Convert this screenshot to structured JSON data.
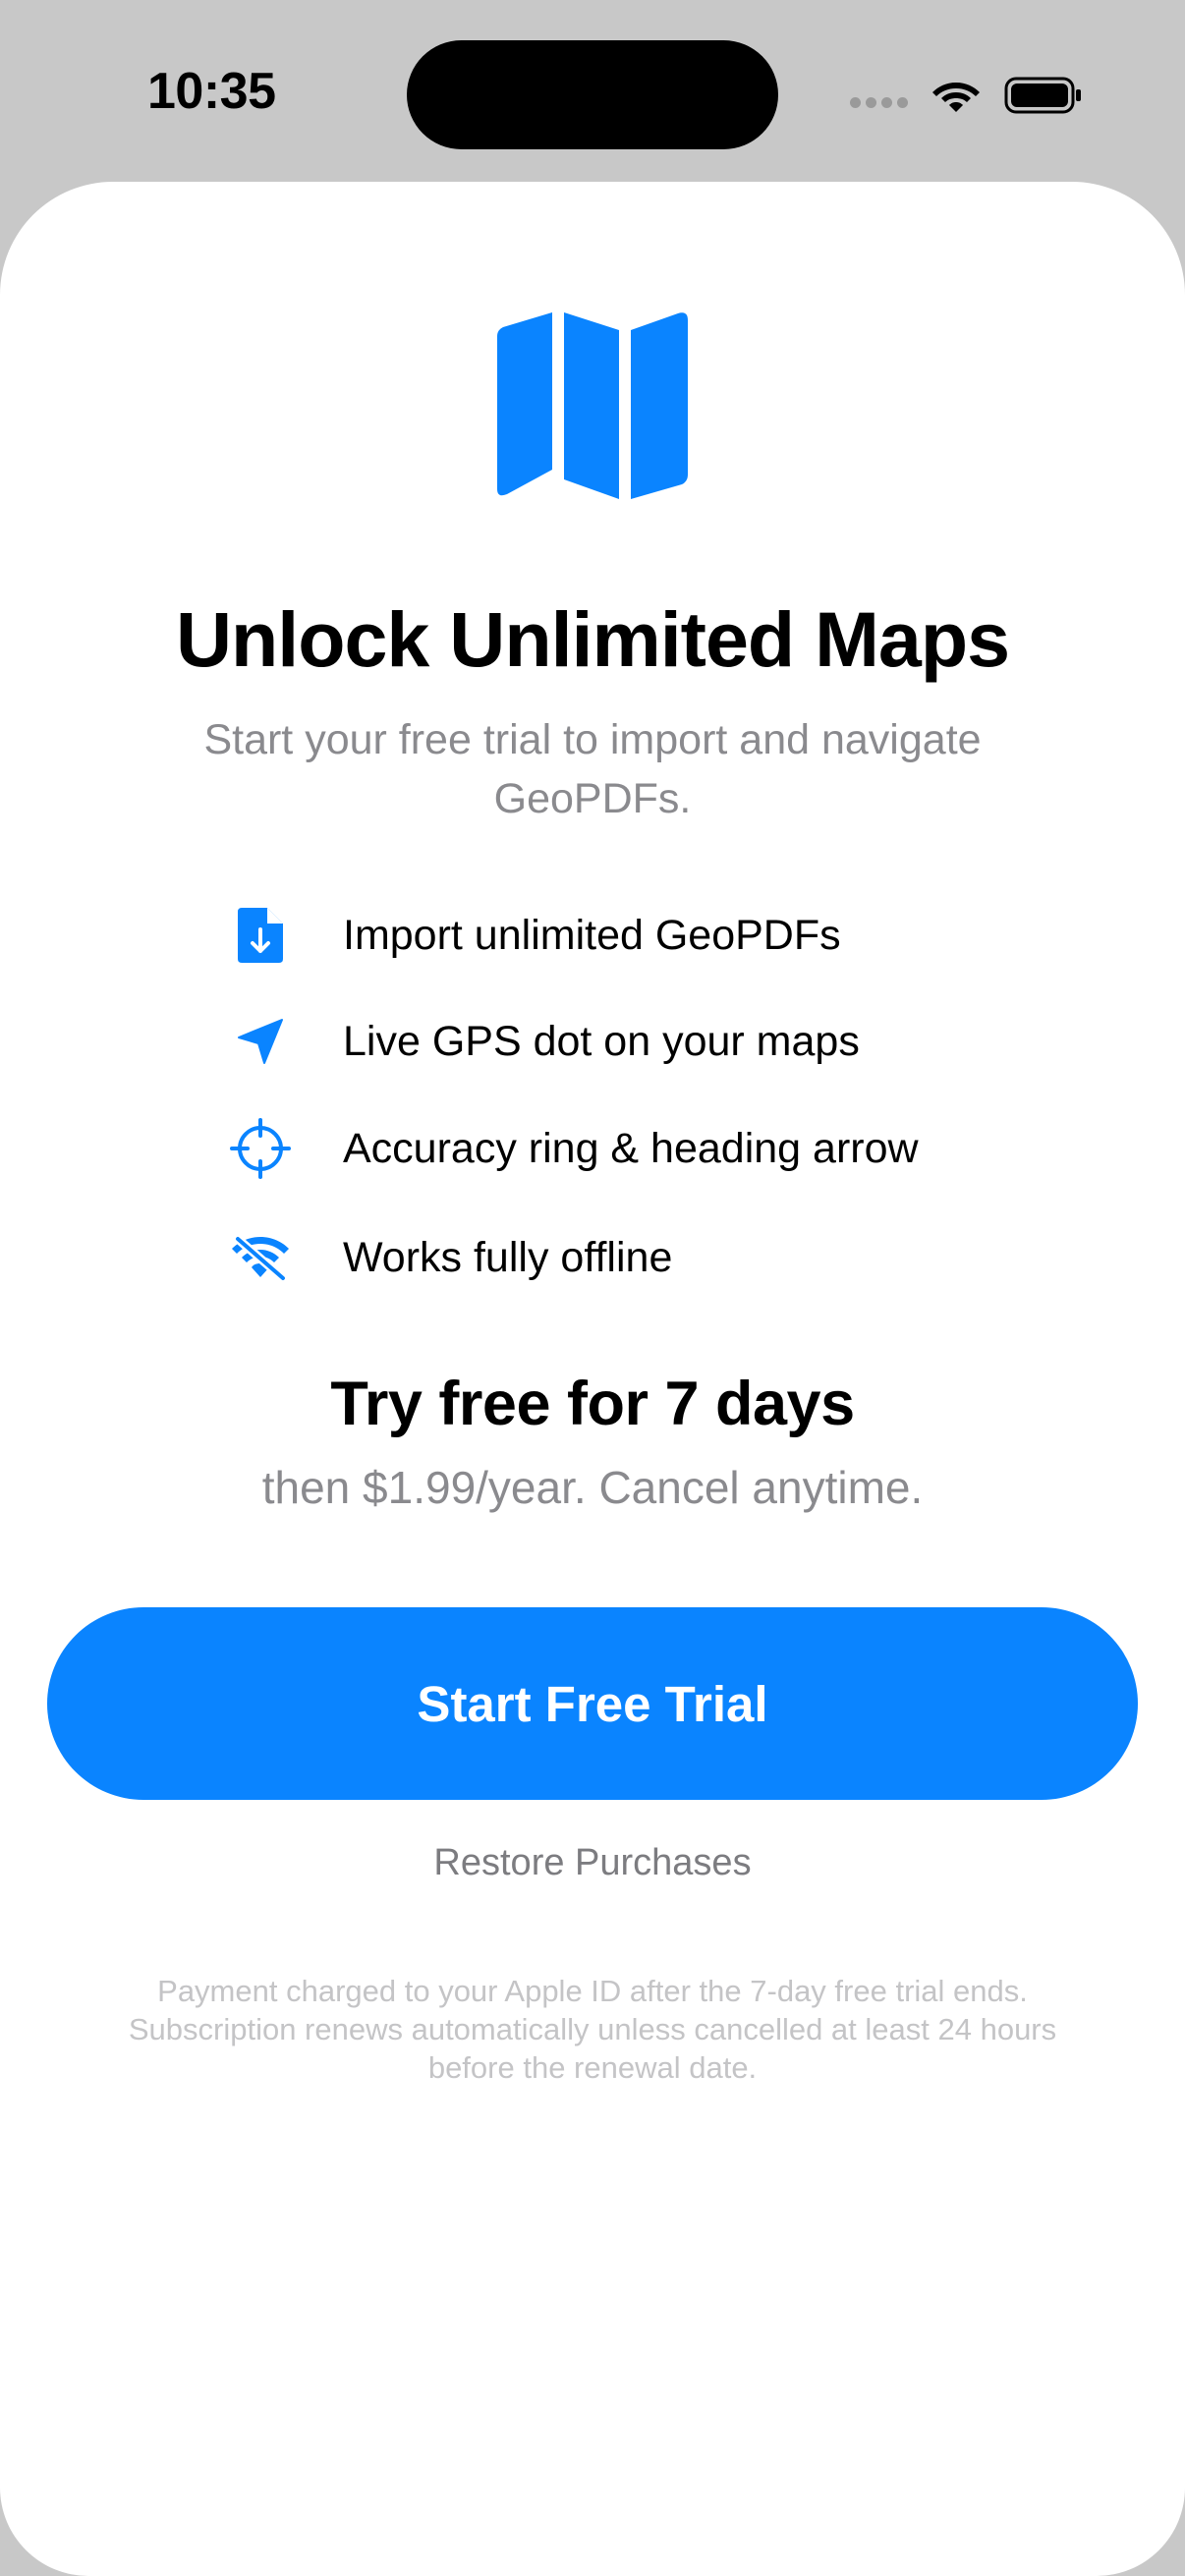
{
  "status_bar": {
    "time": "10:35",
    "icons": [
      "cellular-icon",
      "wifi-icon",
      "battery-icon"
    ]
  },
  "paywall": {
    "icon": "map-icon",
    "title": "Unlock Unlimited Maps",
    "subtitle": "Start your free trial to import and navigate GeoPDFs.",
    "features": [
      {
        "icon": "document-download-icon",
        "label": "Import unlimited GeoPDFs"
      },
      {
        "icon": "location-arrow-icon",
        "label": "Live GPS dot on your maps"
      },
      {
        "icon": "crosshair-icon",
        "label": "Accuracy ring & heading arrow"
      },
      {
        "icon": "wifi-off-icon",
        "label": "Works fully offline"
      }
    ],
    "offer_title": "Try free for 7 days",
    "offer_subtitle": "then $1.99/year. Cancel anytime.",
    "cta_label": "Start Free Trial",
    "restore_label": "Restore Purchases",
    "legal_text": "Payment charged to your Apple ID after the 7-day free trial ends. Subscription renews automatically unless cancelled at least 24 hours before the renewal date."
  },
  "colors": {
    "accent": "#0A84FF",
    "secondary_text": "#8A8A8E",
    "legal_text": "#C4C4C6",
    "backdrop": "#C8C8C8"
  }
}
